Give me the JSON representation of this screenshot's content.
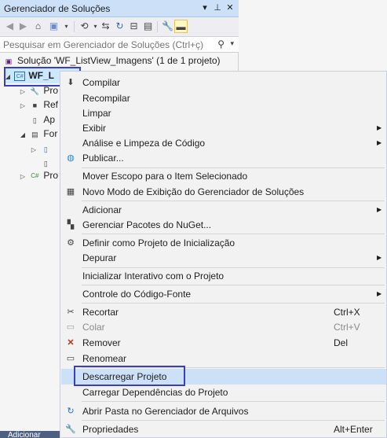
{
  "panel": {
    "title": "Gerenciador de Soluções",
    "title_buttons": [
      "▾",
      "⊥",
      "✕"
    ],
    "search_placeholder": "Pesquisar em Gerenciador de Soluções (Ctrl+ç)"
  },
  "tree": [
    {
      "label": "Solução 'WF_ListView_Imagens' (1 de 1 projeto)"
    },
    {
      "label": "WF_L"
    },
    {
      "label": "Pro"
    },
    {
      "label": "Ref"
    },
    {
      "label": "Ap"
    },
    {
      "label": "For"
    },
    {
      "label": ""
    },
    {
      "label": ""
    },
    {
      "label": "Pro"
    }
  ],
  "menu": {
    "items": [
      {
        "label": "Compilar",
        "icon": "build-icon"
      },
      {
        "label": "Recompilar"
      },
      {
        "label": "Limpar"
      },
      {
        "label": "Exibir",
        "submenu": true
      },
      {
        "label": "Análise e Limpeza de Código",
        "submenu": true
      },
      {
        "label": "Publicar...",
        "icon": "globe-icon"
      },
      {
        "label": "Mover Escopo para o Item Selecionado"
      },
      {
        "label": "Novo Modo de Exibição do Gerenciador de Soluções",
        "icon": "new-view-icon"
      },
      {
        "label": "Adicionar",
        "submenu": true
      },
      {
        "label": "Gerenciar Pacotes do NuGet...",
        "icon": "nuget-icon"
      },
      {
        "label": "Definir como Projeto de Inicialização",
        "icon": "gear-icon"
      },
      {
        "label": "Depurar",
        "submenu": true
      },
      {
        "label": "Inicializar Interativo com o Projeto"
      },
      {
        "label": "Controle do Código-Fonte",
        "submenu": true
      },
      {
        "label": "Recortar",
        "shortcut": "Ctrl+X",
        "icon": "scissors-icon"
      },
      {
        "label": "Colar",
        "shortcut": "Ctrl+V",
        "disabled": true,
        "icon": "paste-icon"
      },
      {
        "label": "Remover",
        "shortcut": "Del",
        "icon": "remove-icon"
      },
      {
        "label": "Renomear",
        "icon": "rename-icon"
      },
      {
        "label": "Descarregar Projeto"
      },
      {
        "label": "Carregar Dependências do Projeto"
      },
      {
        "label": "Abrir Pasta no Gerenciador de Arquivos",
        "icon": "folder-refresh-icon"
      },
      {
        "label": "Propriedades",
        "shortcut": "Alt+Enter",
        "icon": "wrench-icon"
      }
    ]
  },
  "bottom_tab": "Adicionar",
  "colors": {
    "selection": "#cce8ff",
    "highlight_border": "#3b3fbf",
    "titlebar": "#cce0f8",
    "remove_icon": "#c42b1c"
  }
}
